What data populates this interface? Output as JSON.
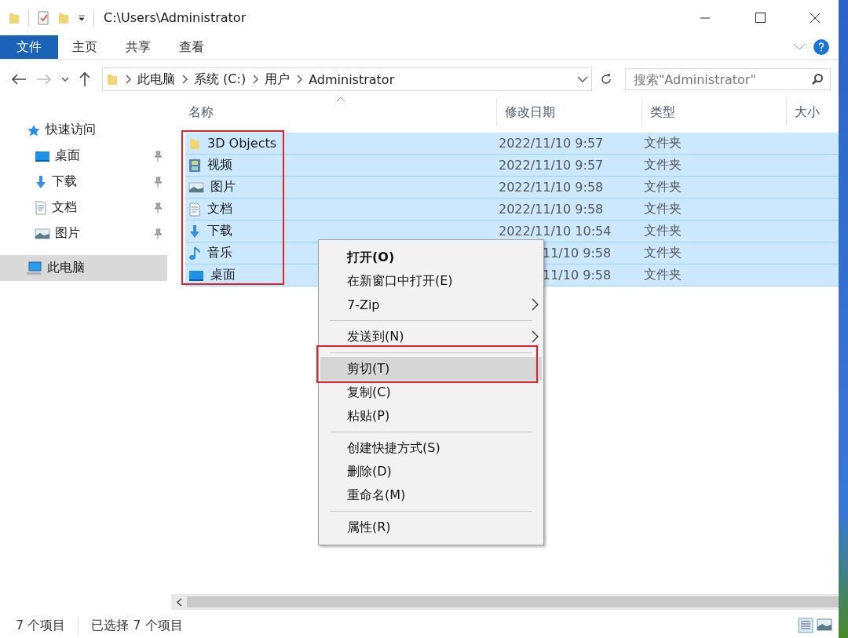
{
  "window": {
    "title": "C:\\Users\\Administrator"
  },
  "ribbon": {
    "tabs": [
      {
        "label": "文件",
        "selected": true
      },
      {
        "label": "主页",
        "selected": false
      },
      {
        "label": "共享",
        "selected": false
      },
      {
        "label": "查看",
        "selected": false
      }
    ]
  },
  "address": {
    "crumbs": [
      "此电脑",
      "系统 (C:)",
      "用户",
      "Administrator"
    ]
  },
  "search": {
    "placeholder": "搜索\"Administrator\""
  },
  "sidebar": {
    "items": [
      {
        "label": "快速访问",
        "kind": "star",
        "pinned": false,
        "selected": false,
        "children": [
          {
            "label": "桌面",
            "kind": "desktop",
            "pinned": true,
            "selected": false
          },
          {
            "label": "下载",
            "kind": "download",
            "pinned": true,
            "selected": false
          },
          {
            "label": "文档",
            "kind": "document",
            "pinned": true,
            "selected": false
          },
          {
            "label": "图片",
            "kind": "picture",
            "pinned": true,
            "selected": false
          }
        ]
      },
      {
        "label": "此电脑",
        "kind": "computer",
        "pinned": false,
        "selected": true
      }
    ]
  },
  "table": {
    "columns": [
      "名称",
      "修改日期",
      "类型",
      "大小"
    ],
    "rows": [
      {
        "name": "3D Objects",
        "kind": "folder",
        "date": "2022/11/10 9:57",
        "type": "文件夹",
        "selected": true,
        "covered": false
      },
      {
        "name": "视频",
        "kind": "video",
        "date": "2022/11/10 9:57",
        "type": "文件夹",
        "selected": true,
        "covered": false
      },
      {
        "name": "图片",
        "kind": "picture",
        "date": "2022/11/10 9:58",
        "type": "文件夹",
        "selected": true,
        "covered": false
      },
      {
        "name": "文档",
        "kind": "document",
        "date": "2022/11/10 9:58",
        "type": "文件夹",
        "selected": true,
        "covered": false
      },
      {
        "name": "下载",
        "kind": "download",
        "date": "2022/11/10 10:54",
        "type": "文件夹",
        "selected": true,
        "covered": false
      },
      {
        "name": "音乐",
        "kind": "music",
        "date": "11/10 9:58",
        "type": "文件夹",
        "selected": true,
        "covered": true
      },
      {
        "name": "桌面",
        "kind": "desktop",
        "date": "11/10 9:58",
        "type": "文件夹",
        "selected": true,
        "covered": true
      }
    ]
  },
  "context_menu": {
    "groups": [
      [
        {
          "label": "打开(O)",
          "default": true,
          "submenu": false,
          "selected": false
        },
        {
          "label": "在新窗口中打开(E)",
          "default": false,
          "submenu": false,
          "selected": false
        },
        {
          "label": "7-Zip",
          "default": false,
          "submenu": true,
          "selected": false
        }
      ],
      [
        {
          "label": "发送到(N)",
          "default": false,
          "submenu": true,
          "selected": false
        }
      ],
      [
        {
          "label": "剪切(T)",
          "default": false,
          "submenu": false,
          "selected": true
        },
        {
          "label": "复制(C)",
          "default": false,
          "submenu": false,
          "selected": false
        },
        {
          "label": "粘贴(P)",
          "default": false,
          "submenu": false,
          "selected": false
        }
      ],
      [
        {
          "label": "创建快捷方式(S)",
          "default": false,
          "submenu": false,
          "selected": false
        },
        {
          "label": "删除(D)",
          "default": false,
          "submenu": false,
          "selected": false
        },
        {
          "label": "重命名(M)",
          "default": false,
          "submenu": false,
          "selected": false
        }
      ],
      [
        {
          "label": "属性(R)",
          "default": false,
          "submenu": false,
          "selected": false
        }
      ]
    ]
  },
  "status_bar": {
    "count": "7 个项目",
    "selection": "已选择 7 个项目"
  }
}
